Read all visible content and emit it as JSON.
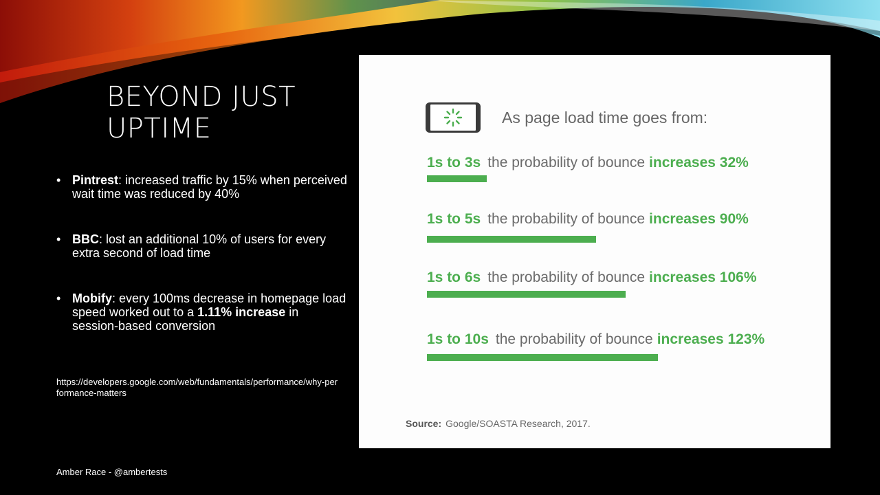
{
  "slide": {
    "title": "BEYOND JUST UPTIME",
    "bullets": [
      {
        "label": "Pintrest",
        "text": ": increased traffic by 15% when perceived wait time was reduced by 40%"
      },
      {
        "label": "BBC",
        "text": ": lost an additional 10% of users for every extra second of load time"
      },
      {
        "label": "Mobify",
        "text_before": ": every 100ms decrease in homepage load speed worked out to a ",
        "highlight": "1.11% increase",
        "text_after": " in session-based conversion"
      }
    ],
    "link": "https://developers.google.com/web/fundamentals/performance/why-performance-matters",
    "footer": "Amber Race - @ambertests"
  },
  "card": {
    "title": "As page load time goes from:",
    "phrase": "the probability of bounce",
    "rows": [
      {
        "range": "1s to 3s",
        "increase": "increases 32%",
        "percent": 32
      },
      {
        "range": "1s to 5s",
        "increase": "increases 90%",
        "percent": 90
      },
      {
        "range": "1s to 6s",
        "increase": "increases 106%",
        "percent": 106
      },
      {
        "range": "1s to 10s",
        "increase": "increases 123%",
        "percent": 123
      }
    ],
    "source_label": "Source:",
    "source_text": "Google/SOASTA Research, 2017."
  },
  "colors": {
    "accent_green": "#4cae4f",
    "background": "#000000",
    "card": "#fdfdfd"
  },
  "icons": [
    "phone-loading-icon"
  ]
}
